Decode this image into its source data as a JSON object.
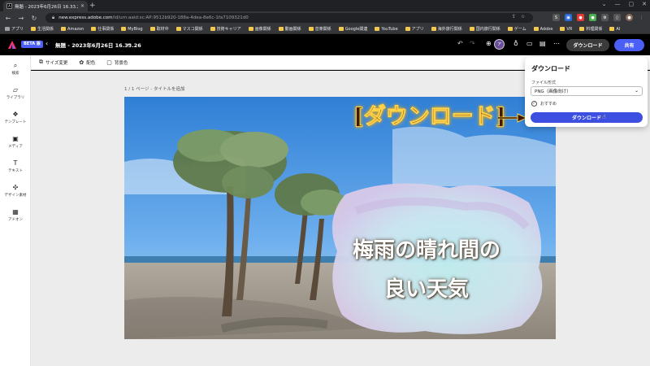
{
  "browser": {
    "tab_title": "無題 - 2023年6月26日 16.33.26",
    "tab_favicon": "A",
    "url_host": "new.express.adobe.com",
    "url_path": "/id/urn:aaid:sc:AP:9512b920-188a-4dea-8e6c-1fa7109321d0",
    "bookmarks": [
      "アプリ",
      "生活関係",
      "Amazon",
      "仕事関係",
      "MyBlog",
      "取材中",
      "マスコ関係",
      "技術キャリア",
      "画像関係",
      "動画関係",
      "音楽関係",
      "Google関連",
      "YouTube",
      "アプリ",
      "海外旅行関係",
      "国内旅行関係",
      "ゲーム",
      "Adobe",
      "VR",
      "料理関係",
      "AI"
    ]
  },
  "header": {
    "beta": "BETA 版",
    "doc_title": "無題 - 2023年6月26日 16.33.26",
    "download": "ダウンロード",
    "share": "共有",
    "avatar_text": "ア"
  },
  "rail": {
    "items": [
      {
        "label": "検索",
        "icon": "search-icon"
      },
      {
        "label": "ライブラリ",
        "icon": "folder-icon"
      },
      {
        "label": "テンプレート",
        "icon": "template-icon"
      },
      {
        "label": "メディア",
        "icon": "media-icon"
      },
      {
        "label": "テキスト",
        "icon": "text-icon"
      },
      {
        "label": "デザイン素材",
        "icon": "shapes-icon"
      },
      {
        "label": "アドオン",
        "icon": "addon-icon"
      }
    ]
  },
  "toolbar": {
    "resize": "サイズ変更",
    "color": "配色",
    "background": "背景色"
  },
  "canvas": {
    "page_label": "1 / 1 ページ - タイトルを追加",
    "art_line1": "梅雨の晴れ間の",
    "art_line2": "良い天気",
    "callout": "[ダウンロード]"
  },
  "download_panel": {
    "title": "ダウンロード",
    "format_label": "ファイル形式",
    "format_value": "PNG（画像向け）",
    "recommended": "おすすめ",
    "button": "ダウンロード"
  },
  "colors": {
    "accent": "#4b5ef5",
    "download_button": "#3d4fe0"
  }
}
